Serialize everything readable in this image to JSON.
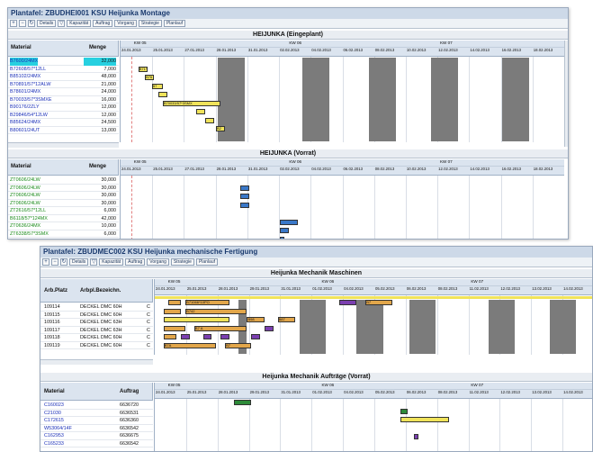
{
  "win1": {
    "title": "Plantafel: ZBUDHEI001 KSU Heijunka Montage",
    "toolbar_buttons": [
      "Details",
      "Kapazität",
      "Auftrag",
      "Vorgang",
      "Strategie",
      "Planlauf"
    ],
    "top_section_title": "HEIJUNKA (Eingeplant)",
    "bottom_section_title": "HEIJUNKA (Vorrat)",
    "col_material": "Material",
    "col_menge": "Menge",
    "weeks": [
      "KW 05",
      "KW 06",
      "KW 07"
    ],
    "dates": [
      "24.01.2013",
      "25.01.2013",
      "27.01.2013",
      "28.01.2013",
      "31.01.2013",
      "02.02.2013",
      "04.02.2013",
      "06.02.2013",
      "08.02.2013",
      "10.02.2013",
      "12.02.2013",
      "14.02.2013",
      "16.02.2013",
      "18.02.2013"
    ],
    "eingeplant": [
      {
        "material": "B7600/24MX",
        "menge": "32,000"
      },
      {
        "material": "B72608/57*12LL",
        "menge": "7,000"
      },
      {
        "material": "B85102/24MX",
        "menge": "48,000"
      },
      {
        "material": "B70891/57*12ALW",
        "menge": "21,000"
      },
      {
        "material": "B78601/24MX",
        "menge": "24,000"
      },
      {
        "material": "B70033/57*3SMXE",
        "menge": "16,000"
      },
      {
        "material": "B90176/2ZLY",
        "menge": "12,000"
      },
      {
        "material": "B29846/54*12LW",
        "menge": "12,000"
      },
      {
        "material": "B85624/24MX",
        "menge": "24,500"
      },
      {
        "material": "B80601/24UT",
        "menge": "13,000"
      }
    ],
    "vorrat": [
      {
        "material": "ZT0606/24LW",
        "menge": "30,000"
      },
      {
        "material": "ZT0606/24LW",
        "menge": "30,000"
      },
      {
        "material": "ZT0606/24LW",
        "menge": "30,000"
      },
      {
        "material": "ZT0606/24LW",
        "menge": "30,000"
      },
      {
        "material": "ZT2616/57*12LL",
        "menge": "6,000"
      },
      {
        "material": "B6118/57*124MX",
        "menge": "42,000"
      },
      {
        "material": "ZT0636/24MX",
        "menge": "10,000"
      },
      {
        "material": "ZT6338/57*3SMX",
        "menge": "6,000"
      },
      {
        "material": "ZT6939/24MX",
        "menge": "8,000"
      }
    ],
    "bar_labels": [
      "B71Y",
      "B76",
      "B7",
      "B70033/57*3SMX",
      "B2"
    ]
  },
  "win2": {
    "title": "Plantafel: ZBUDMEC002 KSU Heijunka mechanische Fertigung",
    "toolbar_buttons": [
      "Details",
      "Kapazität",
      "Auftrag",
      "Vorgang",
      "Strategie",
      "Planlauf"
    ],
    "top_section_title": "Heijunka Mechanik Maschinen",
    "bottom_section_title": "Heijunka Mechanik Aufträge (Vorrat)",
    "col_arbplatz": "Arb.Platz",
    "col_bezeichnung": "Arbpl.Bezeichn.",
    "col_material": "Material",
    "col_auftrag": "Auftrag",
    "weeks": [
      "KW 05",
      "KW 06",
      "KW 07"
    ],
    "dates": [
      "24.01.2013",
      "25.01.2013",
      "28.01.2013",
      "29.01.2013",
      "31.01.2013",
      "01.02.2013",
      "04.02.2013",
      "05.02.2013",
      "06.02.2013",
      "08.02.2013",
      "11.02.2013",
      "12.02.2013",
      "13.02.2013",
      "14.02.2013"
    ],
    "machines": [
      {
        "arbplatz": "109114",
        "bezeichnung": "DECKEL DMC 60H",
        "flag": "C"
      },
      {
        "arbplatz": "109115",
        "bezeichnung": "DECKEL DMC 60H",
        "flag": "C"
      },
      {
        "arbplatz": "109116",
        "bezeichnung": "DECKEL DMC 63H",
        "flag": "C"
      },
      {
        "arbplatz": "109117",
        "bezeichnung": "DECKEL DMC 63H",
        "flag": "C"
      },
      {
        "arbplatz": "109118",
        "bezeichnung": "DECKEL DMC 60H",
        "flag": "C"
      },
      {
        "arbplatz": "109119",
        "bezeichnung": "DECKEL DMC 60H",
        "flag": "C"
      }
    ],
    "auftraege": [
      {
        "material": "C160023",
        "auftrag": "6636720"
      },
      {
        "material": "C21030",
        "auftrag": "6636531"
      },
      {
        "material": "C172615",
        "auftrag": "6636360"
      },
      {
        "material": "W53064/14F",
        "auftrag": "6636542"
      },
      {
        "material": "C162953",
        "auftrag": "6636675"
      },
      {
        "material": "C165233",
        "auftrag": "6636542"
      }
    ],
    "bar_labels": [
      "B71066*10PO",
      "B7",
      "B742",
      "B98",
      "B87",
      "B7 A",
      "B7A",
      "B7"
    ]
  },
  "colors": {
    "selected_row": "#27d0e0",
    "bar_yellow": "#f0e35a",
    "bar_orange": "#e2a64a",
    "bar_blue": "#3a78c8",
    "bar_purple": "#7b3fb0",
    "bar_green": "#2e8b3a",
    "nonwork_gray": "#7b7b7b"
  }
}
